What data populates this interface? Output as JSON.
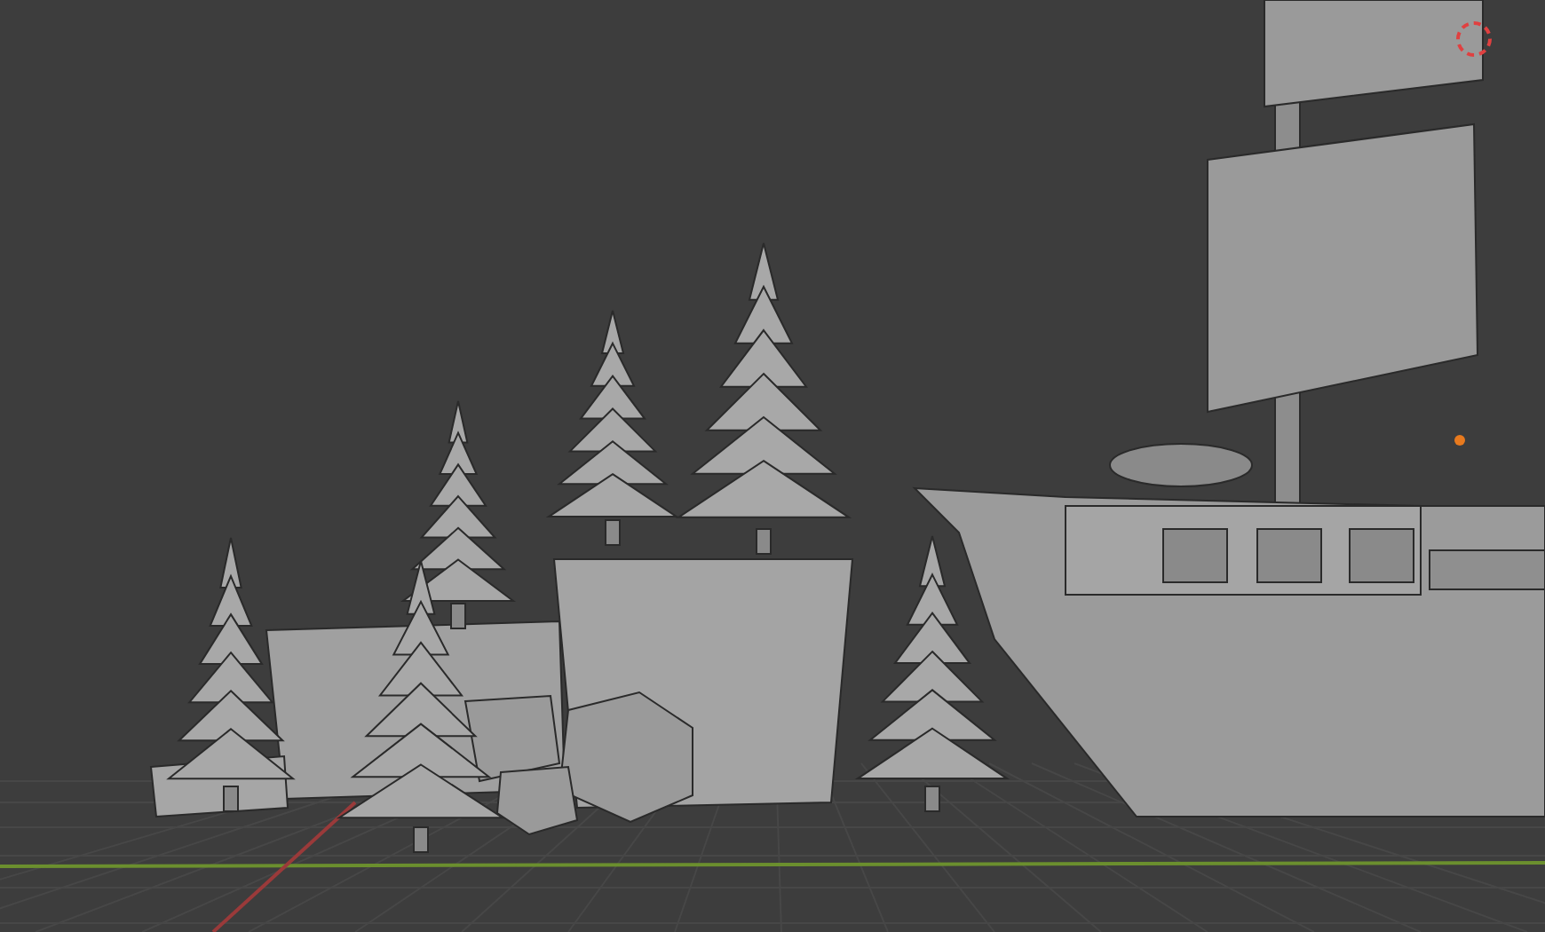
{
  "viewport": {
    "kind": "perspective",
    "x_axis": true,
    "y_axis": true
  }
}
